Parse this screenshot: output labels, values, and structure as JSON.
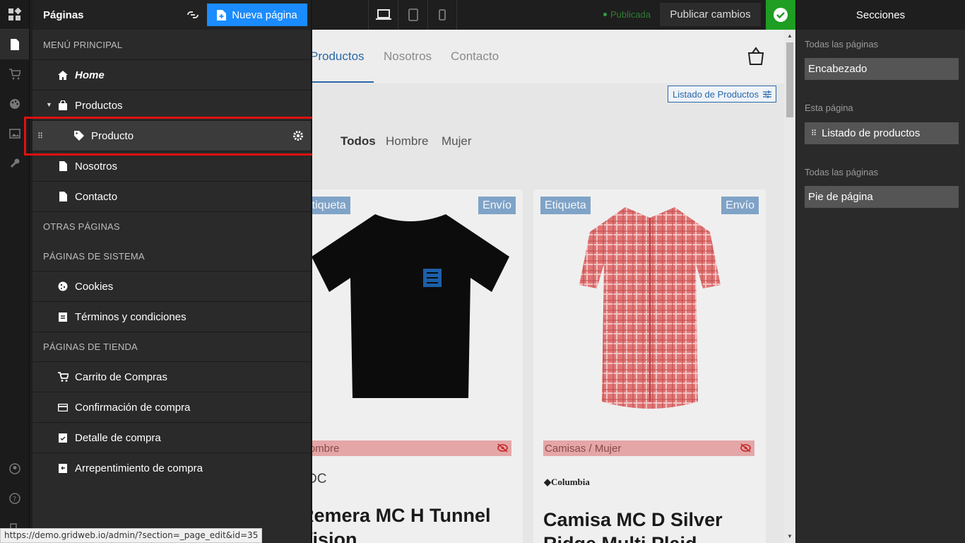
{
  "pages_panel": {
    "title": "Páginas",
    "new_page_label": "Nueva página",
    "sections": [
      {
        "label": "MENÚ PRINCIPAL"
      },
      {
        "label": "OTRAS PÁGINAS"
      },
      {
        "label": "PÁGINAS DE SISTEMA"
      },
      {
        "label": "PÁGINAS DE TIENDA"
      }
    ],
    "main_items": [
      {
        "label": "Home",
        "icon": "home-icon"
      },
      {
        "label": "Productos",
        "icon": "bag-icon"
      },
      {
        "label": "Producto",
        "icon": "tag-icon"
      },
      {
        "label": "Nosotros",
        "icon": "file-icon"
      },
      {
        "label": "Contacto",
        "icon": "file-icon"
      }
    ],
    "system_items": [
      {
        "label": "Cookies",
        "icon": "cookie-icon"
      },
      {
        "label": "Términos y condiciones",
        "icon": "clipboard-icon"
      }
    ],
    "store_items": [
      {
        "label": "Carrito de Compras",
        "icon": "cart-icon"
      },
      {
        "label": "Confirmación de compra",
        "icon": "card-icon"
      },
      {
        "label": "Detalle de compra",
        "icon": "check-clipboard-icon"
      },
      {
        "label": "Arrepentimiento de compra",
        "icon": "return-clipboard-icon"
      }
    ]
  },
  "toolbar": {
    "status": "Publicada",
    "publish_label": "Publicar cambios"
  },
  "preview": {
    "nav": [
      "Productos",
      "Nosotros",
      "Contacto"
    ],
    "block_tag": "Listado de Productos",
    "filters": [
      "Todos",
      "Hombre",
      "Mujer"
    ],
    "cards": [
      {
        "badge_left": "Etiqueta",
        "badge_right": "Envío",
        "category": "Hombre",
        "brand": "DC",
        "title": "Remera MC H Tunnel Vision"
      },
      {
        "badge_left": "Etiqueta",
        "badge_right": "Envío",
        "category": "Camisas / Mujer",
        "brand": "Columbia",
        "title": "Camisa MC D Silver Ridge Multi Plaid"
      }
    ]
  },
  "sections_panel": {
    "title": "Secciones",
    "groups": [
      {
        "label": "Todas las páginas",
        "item": "Encabezado"
      },
      {
        "label": "Esta página",
        "item": "Listado de productos"
      },
      {
        "label": "Todas las páginas",
        "item": "Pie de página"
      }
    ]
  },
  "status_url": "https://demo.gridweb.io/admin/?section=_page_edit&id=35",
  "colors": {
    "accent": "#1a8cff",
    "published": "#1e9e22",
    "highlight": "#e01010",
    "site_link": "#2b67a8"
  }
}
